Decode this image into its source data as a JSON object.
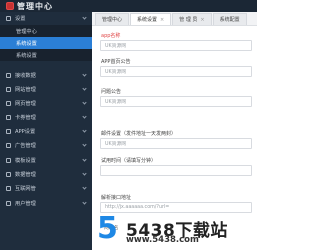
{
  "sidebar": {
    "logo_text": "管理中心",
    "groups": [
      {
        "label": "设置"
      },
      {
        "label": "接收数据"
      },
      {
        "label": "网站管理"
      },
      {
        "label": "网页管理"
      },
      {
        "label": "卡券管理"
      },
      {
        "label": "APP设置"
      },
      {
        "label": "广告管理"
      },
      {
        "label": "模板设置"
      },
      {
        "label": "数据管理"
      },
      {
        "label": "互联网管"
      },
      {
        "label": "用户管理"
      }
    ],
    "sub_items": [
      {
        "label": "管理中心"
      },
      {
        "label": "系统设置"
      },
      {
        "label": "系统设置"
      }
    ]
  },
  "tabs": [
    {
      "label": "管理中心"
    },
    {
      "label": "系统设置"
    },
    {
      "label": "管 理 员"
    },
    {
      "label": "系统配置"
    }
  ],
  "form": {
    "fields": [
      {
        "label": "app名称",
        "value": "UK资源网"
      },
      {
        "label": "APP首页公告",
        "value": "UK资源网"
      },
      {
        "label": "问题公告",
        "value": "UK资源网"
      },
      {
        "label": "邮件设置（发件地址一天发两封）",
        "value": "UK资源网"
      },
      {
        "label": "试用时间（请填写分钟）",
        "value": ""
      },
      {
        "label": "解析接口地址",
        "value": "http://jx.aaaaaa.com/?url="
      }
    ],
    "extra_label": "网站名"
  },
  "watermark": {
    "badge": "5",
    "title": "5438下载站",
    "url": "www.5438.com"
  }
}
